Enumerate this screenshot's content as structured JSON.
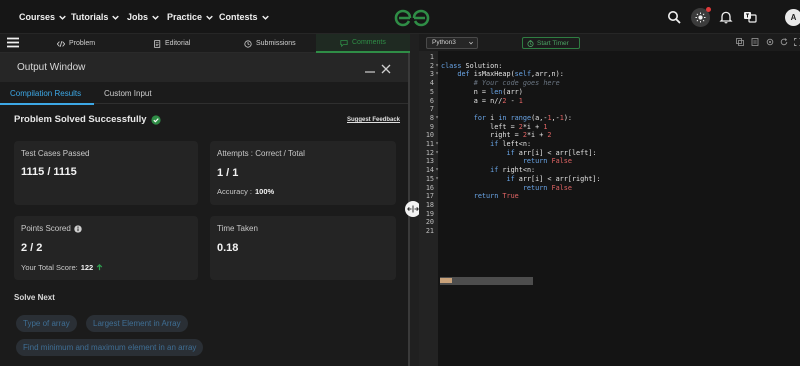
{
  "nav": {
    "items": [
      "Courses",
      "Tutorials",
      "Jobs",
      "Practice",
      "Contests"
    ],
    "avatar_initial": "A"
  },
  "tabs": {
    "items": [
      "Problem",
      "Editorial",
      "Submissions",
      "Comments"
    ],
    "active": "Comments"
  },
  "output": {
    "title": "Output Window",
    "result_tabs": [
      "Compilation Results",
      "Custom Input"
    ],
    "status": "Problem Solved Successfully",
    "suggest": "Suggest Feedback",
    "cards": {
      "tests_label": "Test Cases Passed",
      "tests_value": "1115 / 1115",
      "attempts_label": "Attempts : Correct / Total",
      "attempts_value": "1 / 1",
      "accuracy_label": "Accuracy :",
      "accuracy_value": "100%",
      "points_label": "Points Scored",
      "points_value": "2 / 2",
      "total_label": "Your Total Score:",
      "total_value": "122",
      "time_label": "Time Taken",
      "time_value": "0.18"
    },
    "solve_next_label": "Solve Next",
    "solve_next": [
      "Type of array",
      "Largest Element in Array",
      "Find minimum and maximum element in an array"
    ]
  },
  "editor": {
    "language": "Python3",
    "timer": "Start Timer",
    "lines": [
      {
        "n": "1",
        "fold": "",
        "html": ""
      },
      {
        "n": "2",
        "fold": "▾",
        "html": "<span class='kw'>class</span> Solution:"
      },
      {
        "n": "3",
        "fold": "▾",
        "html": "    <span class='kw'>def</span> isMaxHeap(<span class='kw'>self</span>,arr,n):"
      },
      {
        "n": "4",
        "fold": "",
        "html": "        <span class='cm'># Your code goes here</span>"
      },
      {
        "n": "5",
        "fold": "",
        "html": "        n = <span class='kw'>len</span>(arr)"
      },
      {
        "n": "6",
        "fold": "",
        "html": "        a = n//<span class='str'>2</span> - <span class='str'>1</span>"
      },
      {
        "n": "7",
        "fold": "",
        "html": ""
      },
      {
        "n": "8",
        "fold": "▾",
        "html": "        <span class='kw'>for</span> i <span class='kw'>in</span> <span class='kw'>range</span>(a,-<span class='str'>1</span>,-<span class='str'>1</span>):"
      },
      {
        "n": "9",
        "fold": "",
        "html": "            left = <span class='str'>2</span>*i + <span class='str'>1</span>"
      },
      {
        "n": "10",
        "fold": "",
        "html": "            right = <span class='str'>2</span>*i + <span class='str'>2</span>"
      },
      {
        "n": "11",
        "fold": "▾",
        "html": "            <span class='kw'>if</span> left&lt;n:"
      },
      {
        "n": "12",
        "fold": "▾",
        "html": "                <span class='kw'>if</span> arr[i] &lt; arr[left]:"
      },
      {
        "n": "13",
        "fold": "",
        "html": "                    <span class='kw'>return</span> <span class='str'>False</span>"
      },
      {
        "n": "14",
        "fold": "▾",
        "html": "            <span class='kw'>if</span> right&lt;n:"
      },
      {
        "n": "15",
        "fold": "▾",
        "html": "                <span class='kw'>if</span> arr[i] &lt; arr[right]:"
      },
      {
        "n": "16",
        "fold": "",
        "html": "                    <span class='kw'>return</span> <span class='str'>False</span>"
      },
      {
        "n": "17",
        "fold": "",
        "html": "        <span class='kw'>return</span> <span class='str'>True</span>"
      },
      {
        "n": "18",
        "fold": "",
        "html": ""
      },
      {
        "n": "19",
        "fold": "",
        "html": ""
      },
      {
        "n": "20",
        "fold": "",
        "html": ""
      },
      {
        "n": "21",
        "fold": "",
        "html": ""
      }
    ]
  },
  "colors": {
    "accent_green": "#2f8d46",
    "link_blue": "#3da8e6"
  }
}
